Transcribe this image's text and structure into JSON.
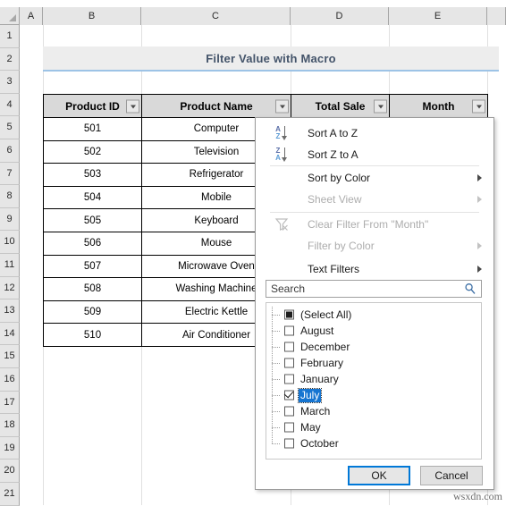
{
  "app": {
    "name": "excel-worksheet"
  },
  "grid": {
    "columns": [
      "A",
      "B",
      "C",
      "D",
      "E"
    ],
    "rows": [
      "1",
      "2",
      "3",
      "4",
      "5",
      "6",
      "7",
      "8",
      "9",
      "10",
      "11",
      "12",
      "13",
      "14",
      "15",
      "16",
      "17",
      "18",
      "19",
      "20",
      "21"
    ]
  },
  "banner": {
    "title": "Filter Value with Macro"
  },
  "table": {
    "headers": [
      "Product ID",
      "Product Name",
      "Total Sale",
      "Month"
    ],
    "rows": [
      [
        "501",
        "Computer",
        "",
        ""
      ],
      [
        "502",
        "Television",
        "",
        ""
      ],
      [
        "503",
        "Refrigerator",
        "",
        ""
      ],
      [
        "504",
        "Mobile",
        "",
        ""
      ],
      [
        "505",
        "Keyboard",
        "",
        ""
      ],
      [
        "506",
        "Mouse",
        "",
        ""
      ],
      [
        "507",
        "Microwave Oven",
        "",
        ""
      ],
      [
        "508",
        "Washing Machine",
        "",
        ""
      ],
      [
        "509",
        "Electric Kettle",
        "",
        ""
      ],
      [
        "510",
        "Air Conditioner",
        "",
        ""
      ]
    ]
  },
  "filter_panel": {
    "menu_items": [
      {
        "label": "Sort A to Z",
        "icon": "sort-ascending-icon",
        "disabled": false,
        "submenu": false
      },
      {
        "label": "Sort Z to A",
        "icon": "sort-descending-icon",
        "disabled": false,
        "submenu": false
      },
      {
        "label": "Sort by Color",
        "icon": "none",
        "disabled": false,
        "submenu": true
      },
      {
        "label": "Sheet View",
        "icon": "none",
        "disabled": true,
        "submenu": true
      },
      {
        "label": "Clear Filter From \"Month\"",
        "icon": "clear-filter-icon",
        "disabled": true,
        "submenu": false
      },
      {
        "label": "Filter by Color",
        "icon": "none",
        "disabled": true,
        "submenu": true
      },
      {
        "label": "Text Filters",
        "icon": "none",
        "disabled": false,
        "submenu": true
      }
    ],
    "search": {
      "placeholder": "Search",
      "value": "",
      "icon": "search-icon"
    },
    "list": [
      {
        "label": "(Select All)",
        "state": "indeterminate",
        "selected": false
      },
      {
        "label": "August",
        "state": "unchecked",
        "selected": false
      },
      {
        "label": "December",
        "state": "unchecked",
        "selected": false
      },
      {
        "label": "February",
        "state": "unchecked",
        "selected": false
      },
      {
        "label": "January",
        "state": "unchecked",
        "selected": false
      },
      {
        "label": "July",
        "state": "checked",
        "selected": true
      },
      {
        "label": "March",
        "state": "unchecked",
        "selected": false
      },
      {
        "label": "May",
        "state": "unchecked",
        "selected": false
      },
      {
        "label": "October",
        "state": "unchecked",
        "selected": false
      }
    ],
    "buttons": {
      "ok": "OK",
      "cancel": "Cancel"
    }
  },
  "watermark": {
    "text": "wsxdn.com"
  },
  "colors": {
    "banner_bg": "#ededed",
    "banner_text": "#44546a",
    "banner_rule": "#9dc3e6",
    "table_header_bg": "#d9d9d9",
    "selection_blue": "#1675d1",
    "focus_blue": "#0078d7",
    "header_gray": "#e6e6e6"
  }
}
